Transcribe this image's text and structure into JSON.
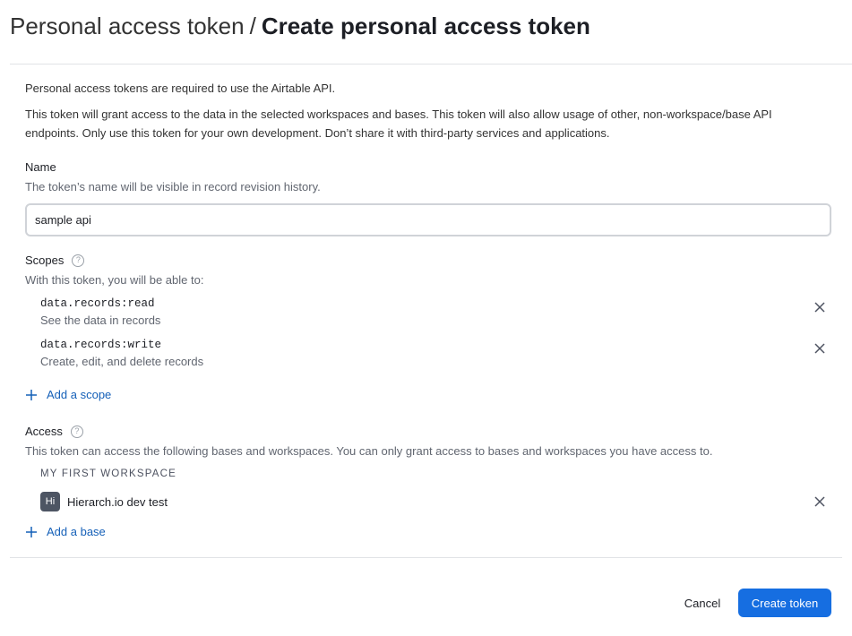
{
  "header": {
    "breadcrumb_parent": "Personal access token",
    "separator": "/",
    "title": "Create personal access token"
  },
  "intro": {
    "line1": "Personal access tokens are required to use the Airtable API.",
    "line2": "This token will grant access to the data in the selected workspaces and bases. This token will also allow usage of other, non-workspace/base API endpoints. Only use this token for your own development. Don’t share it with third-party services and applications."
  },
  "name_section": {
    "label": "Name",
    "help": "The token’s name will be visible in record revision history.",
    "value": "sample api"
  },
  "scopes_section": {
    "label": "Scopes",
    "help_icon": "question-circle-icon",
    "help": "With this token, you will be able to:",
    "items": [
      {
        "name": "data.records:read",
        "description": "See the data in records"
      },
      {
        "name": "data.records:write",
        "description": "Create, edit, and delete records"
      }
    ],
    "add_label": "Add a scope"
  },
  "access_section": {
    "label": "Access",
    "help_icon": "question-circle-icon",
    "help": "This token can access the following bases and workspaces. You can only grant access to bases and workspaces you have access to.",
    "workspace_label": "My First Workspace",
    "bases": [
      {
        "initials": "Hi",
        "name": "Hierarch.io dev test"
      }
    ],
    "add_label": "Add a base"
  },
  "footer": {
    "cancel_label": "Cancel",
    "create_label": "Create token"
  },
  "colors": {
    "primary_button": "#166ee1",
    "link": "#1560b8",
    "avatar_bg": "#4d5563"
  }
}
